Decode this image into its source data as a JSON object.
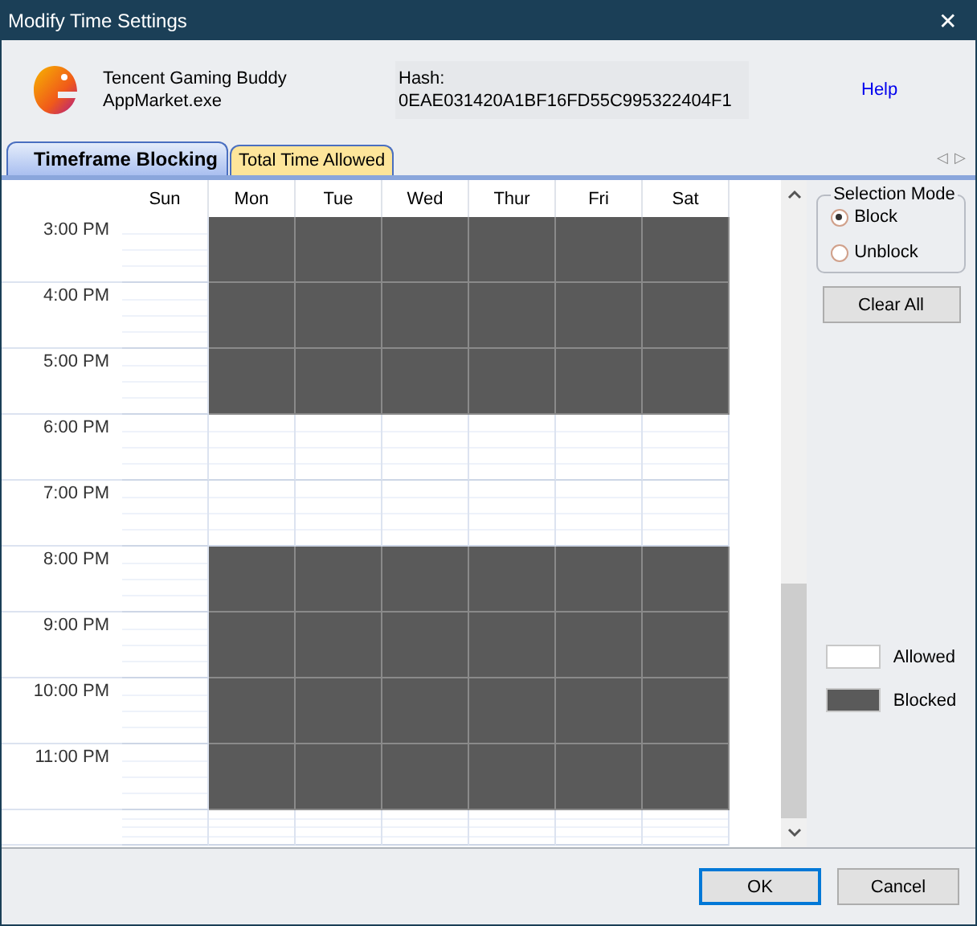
{
  "window": {
    "title": "Modify Time Settings",
    "close": "✕"
  },
  "app": {
    "name": "Tencent Gaming Buddy",
    "file": "AppMarket.exe",
    "hash_label": "Hash:",
    "hash": "0EAE031420A1BF16FD55C995322404F1",
    "help": "Help"
  },
  "tabs": [
    {
      "label": "Timeframe Blocking",
      "selected": true
    },
    {
      "label": "Total Time Allowed",
      "selected": false
    }
  ],
  "tab_scroll": [
    "◁",
    "▷"
  ],
  "days": [
    "Sun",
    "Mon",
    "Tue",
    "Wed",
    "Thur",
    "Fri",
    "Sat"
  ],
  "rows": [
    {
      "time": "3:00 PM",
      "blocked": [
        false,
        true,
        true,
        true,
        true,
        true,
        true
      ]
    },
    {
      "time": "4:00 PM",
      "blocked": [
        false,
        true,
        true,
        true,
        true,
        true,
        true
      ]
    },
    {
      "time": "5:00 PM",
      "blocked": [
        false,
        true,
        true,
        true,
        true,
        true,
        true
      ]
    },
    {
      "time": "6:00 PM",
      "blocked": [
        false,
        false,
        false,
        false,
        false,
        false,
        false
      ]
    },
    {
      "time": "7:00 PM",
      "blocked": [
        false,
        false,
        false,
        false,
        false,
        false,
        false
      ]
    },
    {
      "time": "8:00 PM",
      "blocked": [
        false,
        true,
        true,
        true,
        true,
        true,
        true
      ]
    },
    {
      "time": "9:00 PM",
      "blocked": [
        false,
        true,
        true,
        true,
        true,
        true,
        true
      ]
    },
    {
      "time": "10:00 PM",
      "blocked": [
        false,
        true,
        true,
        true,
        true,
        true,
        true
      ]
    },
    {
      "time": "11:00 PM",
      "blocked": [
        false,
        true,
        true,
        true,
        true,
        true,
        true
      ]
    },
    {
      "blocked": [
        false,
        false,
        false,
        false,
        false,
        false,
        false
      ]
    }
  ],
  "selection_mode": {
    "title": "Selection Mode",
    "options": [
      {
        "label": "Block",
        "selected": true
      },
      {
        "label": "Unblock",
        "selected": false
      }
    ]
  },
  "clear_all": "Clear All",
  "legend": [
    {
      "label": "Allowed",
      "color": "#ffffff"
    },
    {
      "label": "Blocked",
      "color": "#5a5a5a"
    }
  ],
  "buttons": [
    {
      "label": "OK",
      "kind": "default"
    },
    {
      "label": "Cancel",
      "kind": "normal"
    }
  ]
}
